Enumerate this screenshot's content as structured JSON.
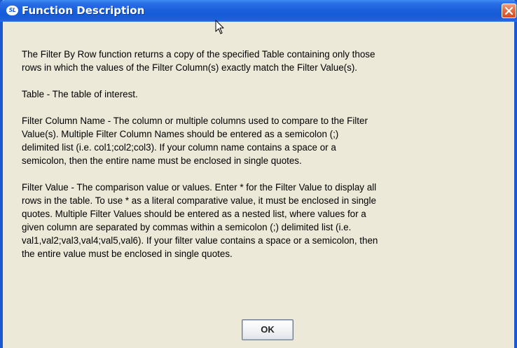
{
  "window": {
    "title": "Function Description",
    "app_icon_text": "SL",
    "close_icon": "close-x-icon"
  },
  "content": {
    "paragraphs": [
      "The Filter By Row function returns a copy of the specified Table containing only those\nrows in which the values of the Filter Column(s) exactly match the Filter Value(s).",
      "Table - The table of interest.",
      "Filter Column Name - The column or multiple columns used to compare to the Filter\nValue(s).  Multiple Filter Column Names should be entered as a semicolon (;)\ndelimited list (i.e. col1;col2;col3). If your column name contains a space or a\nsemicolon, then the entire name must be enclosed in single quotes.",
      "Filter Value - The comparison value or values. Enter * for the Filter Value to display all\nrows in the table. To use * as a literal comparative value, it must be enclosed in single\nquotes. Multiple Filter Values should be entered as a nested list, where values for a\ngiven column are separated by commas within a semicolon (;) delimited list (i.e.\nval1,val2;val3,val4;val5,val6). If your filter value contains a space or a semicolon, then\nthe entire value must be enclosed in single quotes."
    ]
  },
  "buttons": {
    "ok_label": "OK"
  },
  "colors": {
    "titlebar": "#1c5fdc",
    "dialog_background": "#ece9d8",
    "close_button": "#d84a22"
  }
}
